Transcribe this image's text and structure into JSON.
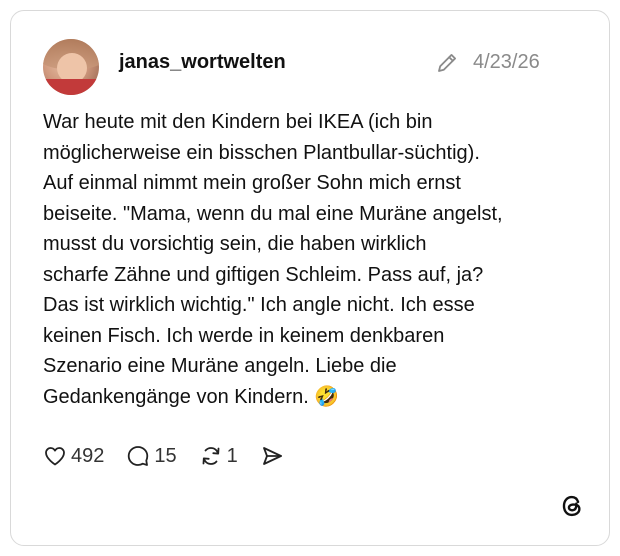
{
  "post": {
    "username": "janas_wortwelten",
    "date": "4/23/26",
    "text": "War heute mit den Kindern bei IKEA (ich bin\nmöglicherweise ein bisschen Plantbullar-süchtig).\nAuf einmal nimmt mein großer Sohn mich ernst\nbeiseite. \"Mama, wenn du mal eine Muräne angelst,\nmusst du vorsichtig sein, die haben wirklich\nscharfe Zähne und giftigen Schleim. Pass auf, ja?\nDas ist wirklich wichtig.\" Ich angle nicht. Ich esse\nkeinen Fisch. Ich werde in keinem denkbaren\nSzenario eine Muräne angeln. Liebe die\nGedankengänge von Kindern. 🤣"
  },
  "actions": {
    "likes": "492",
    "replies": "15",
    "reposts": "1"
  },
  "icons": {
    "like": "heart-icon",
    "reply": "speech-bubble-icon",
    "repost": "repost-arrows-icon",
    "share": "send-icon",
    "edit": "pencil-icon",
    "brand": "threads-logo"
  }
}
